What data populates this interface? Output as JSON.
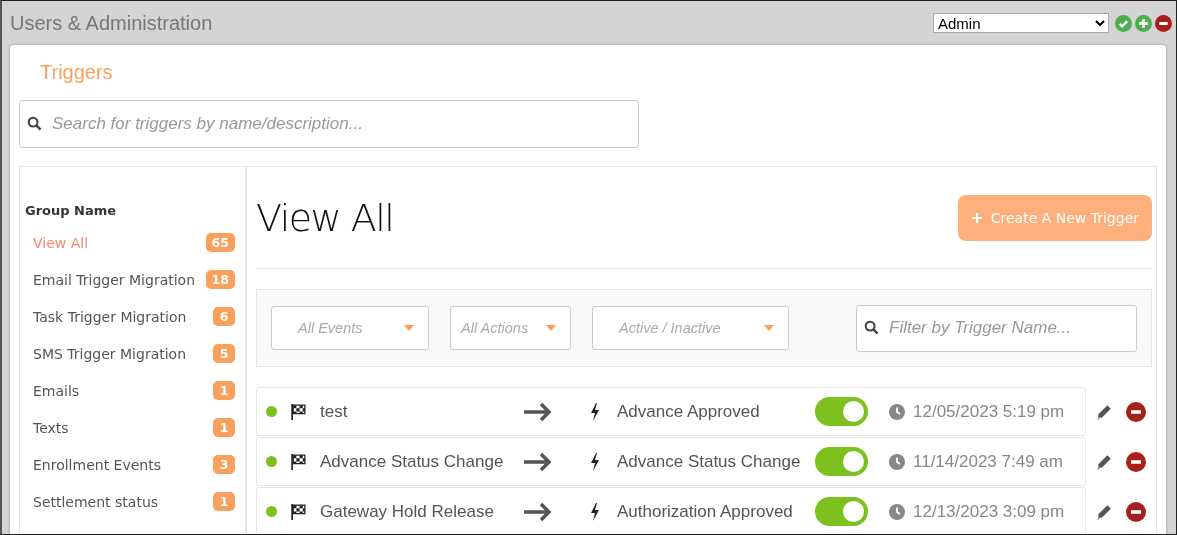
{
  "window": {
    "title": "Users & Administration"
  },
  "role_select": {
    "value": "Admin"
  },
  "page": {
    "title": "Triggers",
    "search": {
      "placeholder": "Search for triggers by name/description..."
    }
  },
  "sidebar": {
    "heading": "Group Name",
    "items": [
      {
        "label": "View All",
        "count": "65",
        "selected": true
      },
      {
        "label": "Email Trigger Migration",
        "count": "18",
        "selected": false
      },
      {
        "label": "Task Trigger Migration",
        "count": "6",
        "selected": false
      },
      {
        "label": "SMS Trigger Migration",
        "count": "5",
        "selected": false
      },
      {
        "label": "Emails",
        "count": "1",
        "selected": false
      },
      {
        "label": "Texts",
        "count": "1",
        "selected": false
      },
      {
        "label": "Enrollment Events",
        "count": "3",
        "selected": false
      },
      {
        "label": "Settlement status",
        "count": "1",
        "selected": false
      }
    ]
  },
  "main": {
    "title": "View All",
    "create_button": "Create A New Trigger",
    "filters": [
      {
        "placeholder": "All Events"
      },
      {
        "placeholder": "All Actions"
      },
      {
        "placeholder": "Active / Inactive"
      }
    ],
    "filter_search": {
      "placeholder": "Filter by Trigger Name..."
    },
    "triggers": [
      {
        "name": "test",
        "action": "Advance Approved",
        "active": true,
        "on": true,
        "date": "12/05/2023 5:19 pm"
      },
      {
        "name": "Advance Status Change",
        "action": "Advance Status Change",
        "active": true,
        "on": true,
        "date": "11/14/2023 7:49 am"
      },
      {
        "name": "Gateway Hold Release",
        "action": "Authorization Approved",
        "active": true,
        "on": true,
        "date": "12/13/2023 3:09 pm"
      }
    ]
  }
}
